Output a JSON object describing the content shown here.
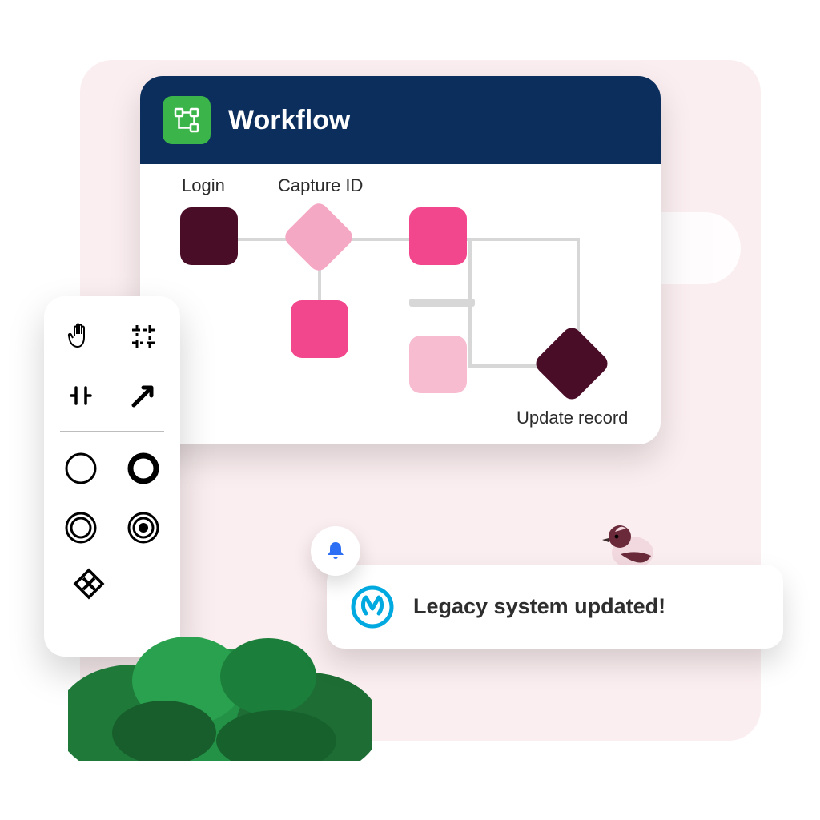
{
  "workflow": {
    "title": "Workflow",
    "nodes": {
      "login_label": "Login",
      "capture_id_label": "Capture ID",
      "update_record_label": "Update record"
    }
  },
  "notification": {
    "text": "Legacy system updated!"
  },
  "icons": {
    "workflow": "workflow-icon",
    "bell": "bell-icon",
    "mulesoft": "mulesoft-icon"
  },
  "palette": {
    "tools": [
      "hand-icon",
      "crop-icon",
      "split-icon",
      "arrow-icon",
      "circle-thin-icon",
      "circle-bold-icon",
      "circle-double-icon",
      "circle-target-icon",
      "diamond-x-icon"
    ]
  },
  "colors": {
    "header_bg": "#0b2e5c",
    "accent_green": "#3bb54a",
    "node_dark": "#4a0d27",
    "node_pink_light": "#f5a8c3",
    "node_pink": "#f2478d",
    "node_pink_soft": "#f7bcd0",
    "backdrop": "#fbeef0",
    "bell_blue": "#2d6ff4",
    "mulesoft_blue": "#00a9e0"
  }
}
